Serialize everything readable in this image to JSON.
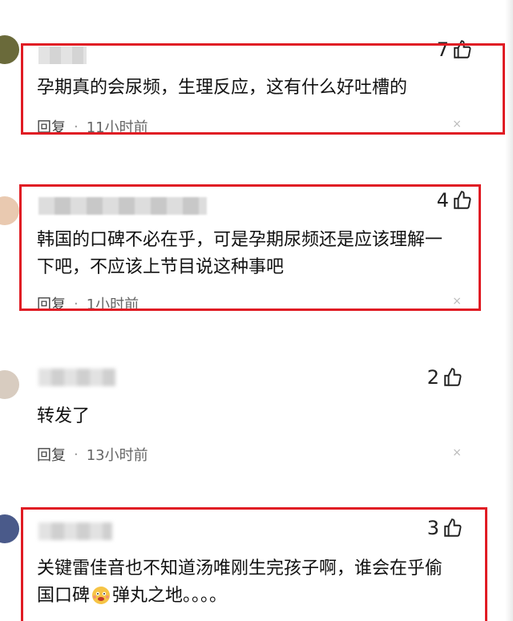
{
  "comments": [
    {
      "username": "",
      "likes": "7",
      "text": "孕期真的会尿频，生理反应，这有什么好吐槽的",
      "reply_label": "回复",
      "time": "11小时前",
      "close": "×"
    },
    {
      "username": "",
      "likes": "4",
      "text": "韩国的口碑不必在乎，可是孕期尿频还是应该理解一下吧，不应该上节目说这种事吧",
      "reply_label": "回复",
      "time": "1小时前",
      "close": "×"
    },
    {
      "username": "",
      "likes": "2",
      "text": "转发了",
      "reply_label": "回复",
      "time": "13小时前",
      "close": "×"
    },
    {
      "username": "",
      "likes": "3",
      "text_before_emoji": "关键雷佳音也不知道汤唯刚生完孩子啊，谁会在乎偷国口碑",
      "emoji": "emoji-face-icon",
      "text_after_emoji": "弹丸之地。。。。",
      "reply_label": "回复",
      "time": "",
      "close": "×"
    }
  ],
  "colors": {
    "highlight": "#e01c24",
    "meta": "#666666"
  },
  "icons": {
    "like": "thumbs-up-icon",
    "close": "close-icon"
  }
}
